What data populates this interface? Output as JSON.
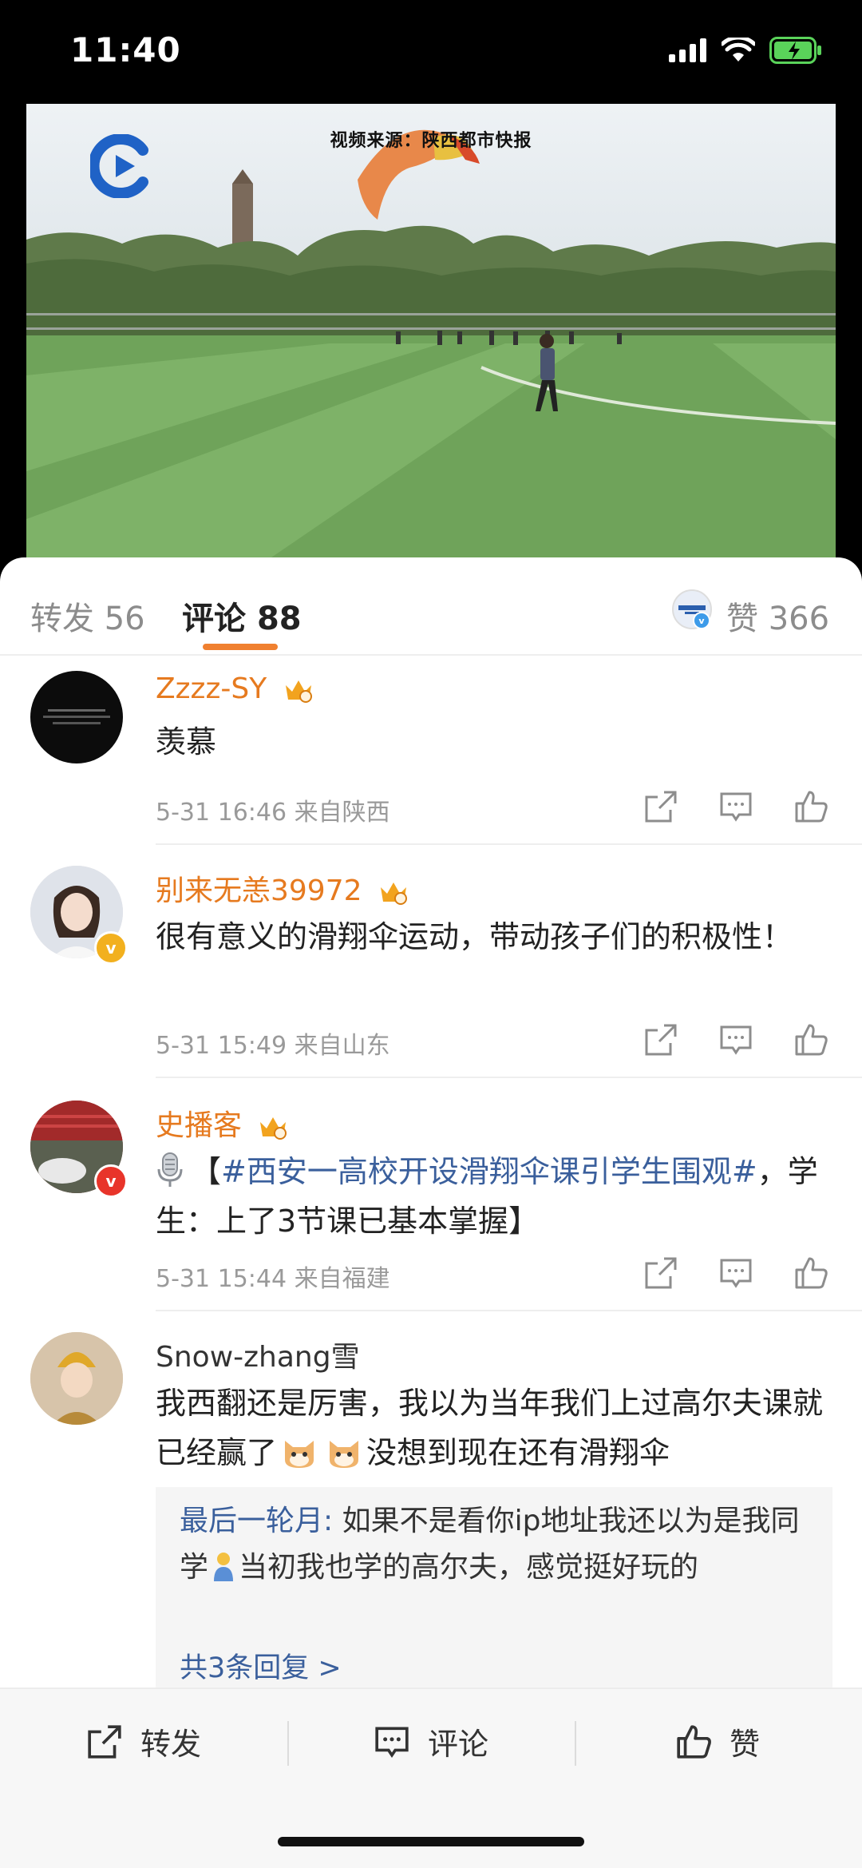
{
  "status_bar": {
    "time": "11:40"
  },
  "video": {
    "source_caption": "视频来源：陕西都市快报"
  },
  "tabs": {
    "repost": {
      "label": "转发",
      "count": "56"
    },
    "comments": {
      "label": "评论",
      "count": "88"
    },
    "likes": {
      "label": "赞",
      "count": "366"
    }
  },
  "comments": [
    {
      "user": "Zzzz-SY",
      "text": "羡慕",
      "time": "5-31 16:46",
      "location": "来自陕西"
    },
    {
      "user": "别来无恙39972",
      "text": "很有意义的滑翔伞运动，带动孩子们的积极性！",
      "time": "5-31 15:49",
      "location": "来自山东"
    },
    {
      "user": "史播客",
      "text_icon": "microphone-icon",
      "text_pre": "【",
      "text_link": "#西安一高校开设滑翔伞课引学生围观#",
      "text_post": "，学生：上了3节课已基本掌握】",
      "time": "5-31 15:44",
      "location": "来自福建"
    },
    {
      "user": "Snow-zhang雪",
      "text_pre": "我西翻还是厉害，我以为当年我们上过高尔夫课就已经赢了",
      "text_post": "没想到现在还有滑翔伞",
      "reply": {
        "user": "最后一轮月",
        "sep": ": ",
        "text_pre": "如果不是看你ip地址我还以为是我同学",
        "text_post": "当初我也学的高尔夫，感觉挺好玩的",
        "more": "共3条回复 >"
      }
    }
  ],
  "bottom_bar": {
    "repost": "转发",
    "comment": "评论",
    "like": "赞"
  },
  "colors": {
    "accent": "#f08030",
    "username": "#e67a1f",
    "link": "#3a5f9c",
    "verified_gold": "#f2b01e",
    "verified_red": "#e8342a"
  }
}
